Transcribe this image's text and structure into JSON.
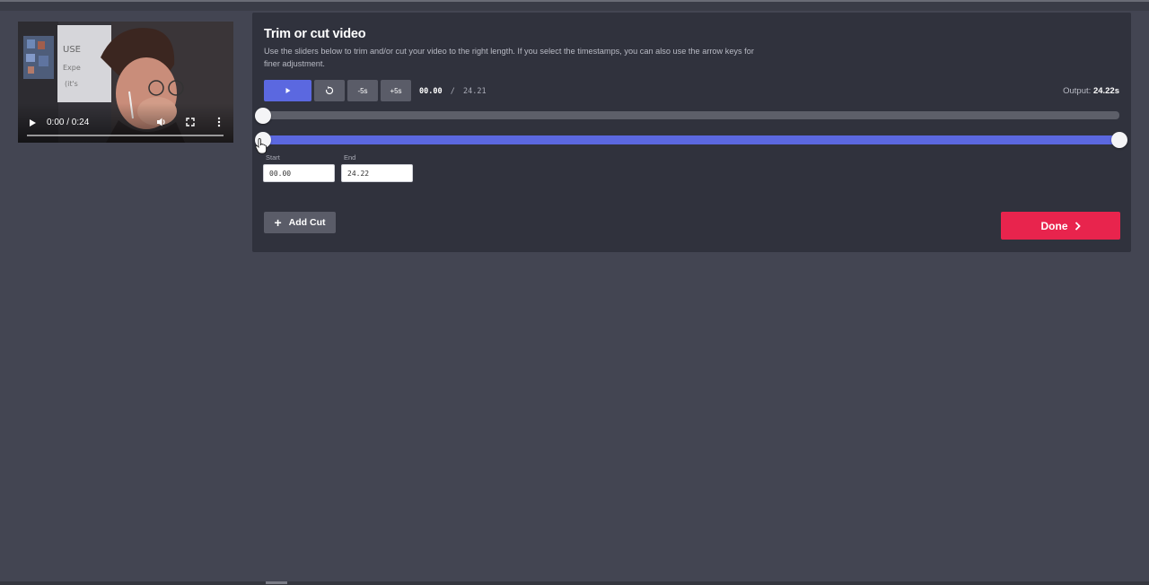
{
  "video": {
    "time_display": "0:00 / 0:24",
    "progress": 0
  },
  "panel": {
    "title": "Trim or cut video",
    "description": "Use the sliders below to trim and/or cut your video to the right length. If you select the timestamps, you can also use the arrow keys for finer adjustment."
  },
  "controls": {
    "back_label": "-5s",
    "forward_label": "+5s",
    "current_time": "00.00",
    "separator": "/",
    "total_time": "24.21"
  },
  "output": {
    "label": "Output:",
    "value": "24.22s"
  },
  "range": {
    "start_label": "Start",
    "end_label": "End",
    "start_value": "00.00",
    "end_value": "24.22",
    "start_fraction": 0,
    "end_fraction": 1
  },
  "actions": {
    "add_cut_label": "Add Cut",
    "done_label": "Done"
  },
  "colors": {
    "accent": "#5b68e0",
    "done": "#e8244d",
    "panel": "#30323d",
    "background": "#434552"
  }
}
